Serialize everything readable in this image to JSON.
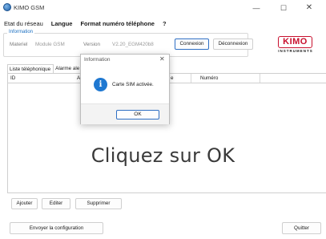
{
  "window": {
    "title": "KIMO GSM",
    "minimize": "—",
    "maximize": "☐",
    "close": "✕"
  },
  "menu": [
    {
      "label": "Etat du réseau",
      "bold": false
    },
    {
      "label": "Langue",
      "bold": true
    },
    {
      "label": "Format numéro téléphone",
      "bold": true
    },
    {
      "label": "?",
      "bold": true
    }
  ],
  "info_group": {
    "legend": "Information",
    "materiel_label": "Materiel",
    "materiel_value": "Module GSM",
    "version_label": "Version",
    "version_value": "V2.20_EGM420b8",
    "connect_button": "Connexion",
    "disconnect_button": "Déconnexion"
  },
  "logo": {
    "brand": "KIMO",
    "subtitle": "INSTRUMENTS",
    "color": "#c8102e"
  },
  "tabs": [
    "Liste téléphonique",
    "Alarme ale"
  ],
  "list": {
    "columns": [
      "ID",
      "Al",
      "e",
      "Numéro"
    ]
  },
  "overlay_text": "Cliquez sur OK",
  "actions": {
    "add": "Ajouter",
    "edit": "Editer",
    "delete": "Supprimer"
  },
  "footer": {
    "send_config": "Envoyer la configuration",
    "quit": "Quitter"
  },
  "dialog": {
    "title": "Information",
    "close": "✕",
    "icon": "info-icon",
    "message": "Carte SIM activée.",
    "ok": "OK"
  },
  "colors": {
    "accent": "#2f6fc4",
    "info_blue": "#1f78d1",
    "legend_blue": "#1a6fc1"
  }
}
